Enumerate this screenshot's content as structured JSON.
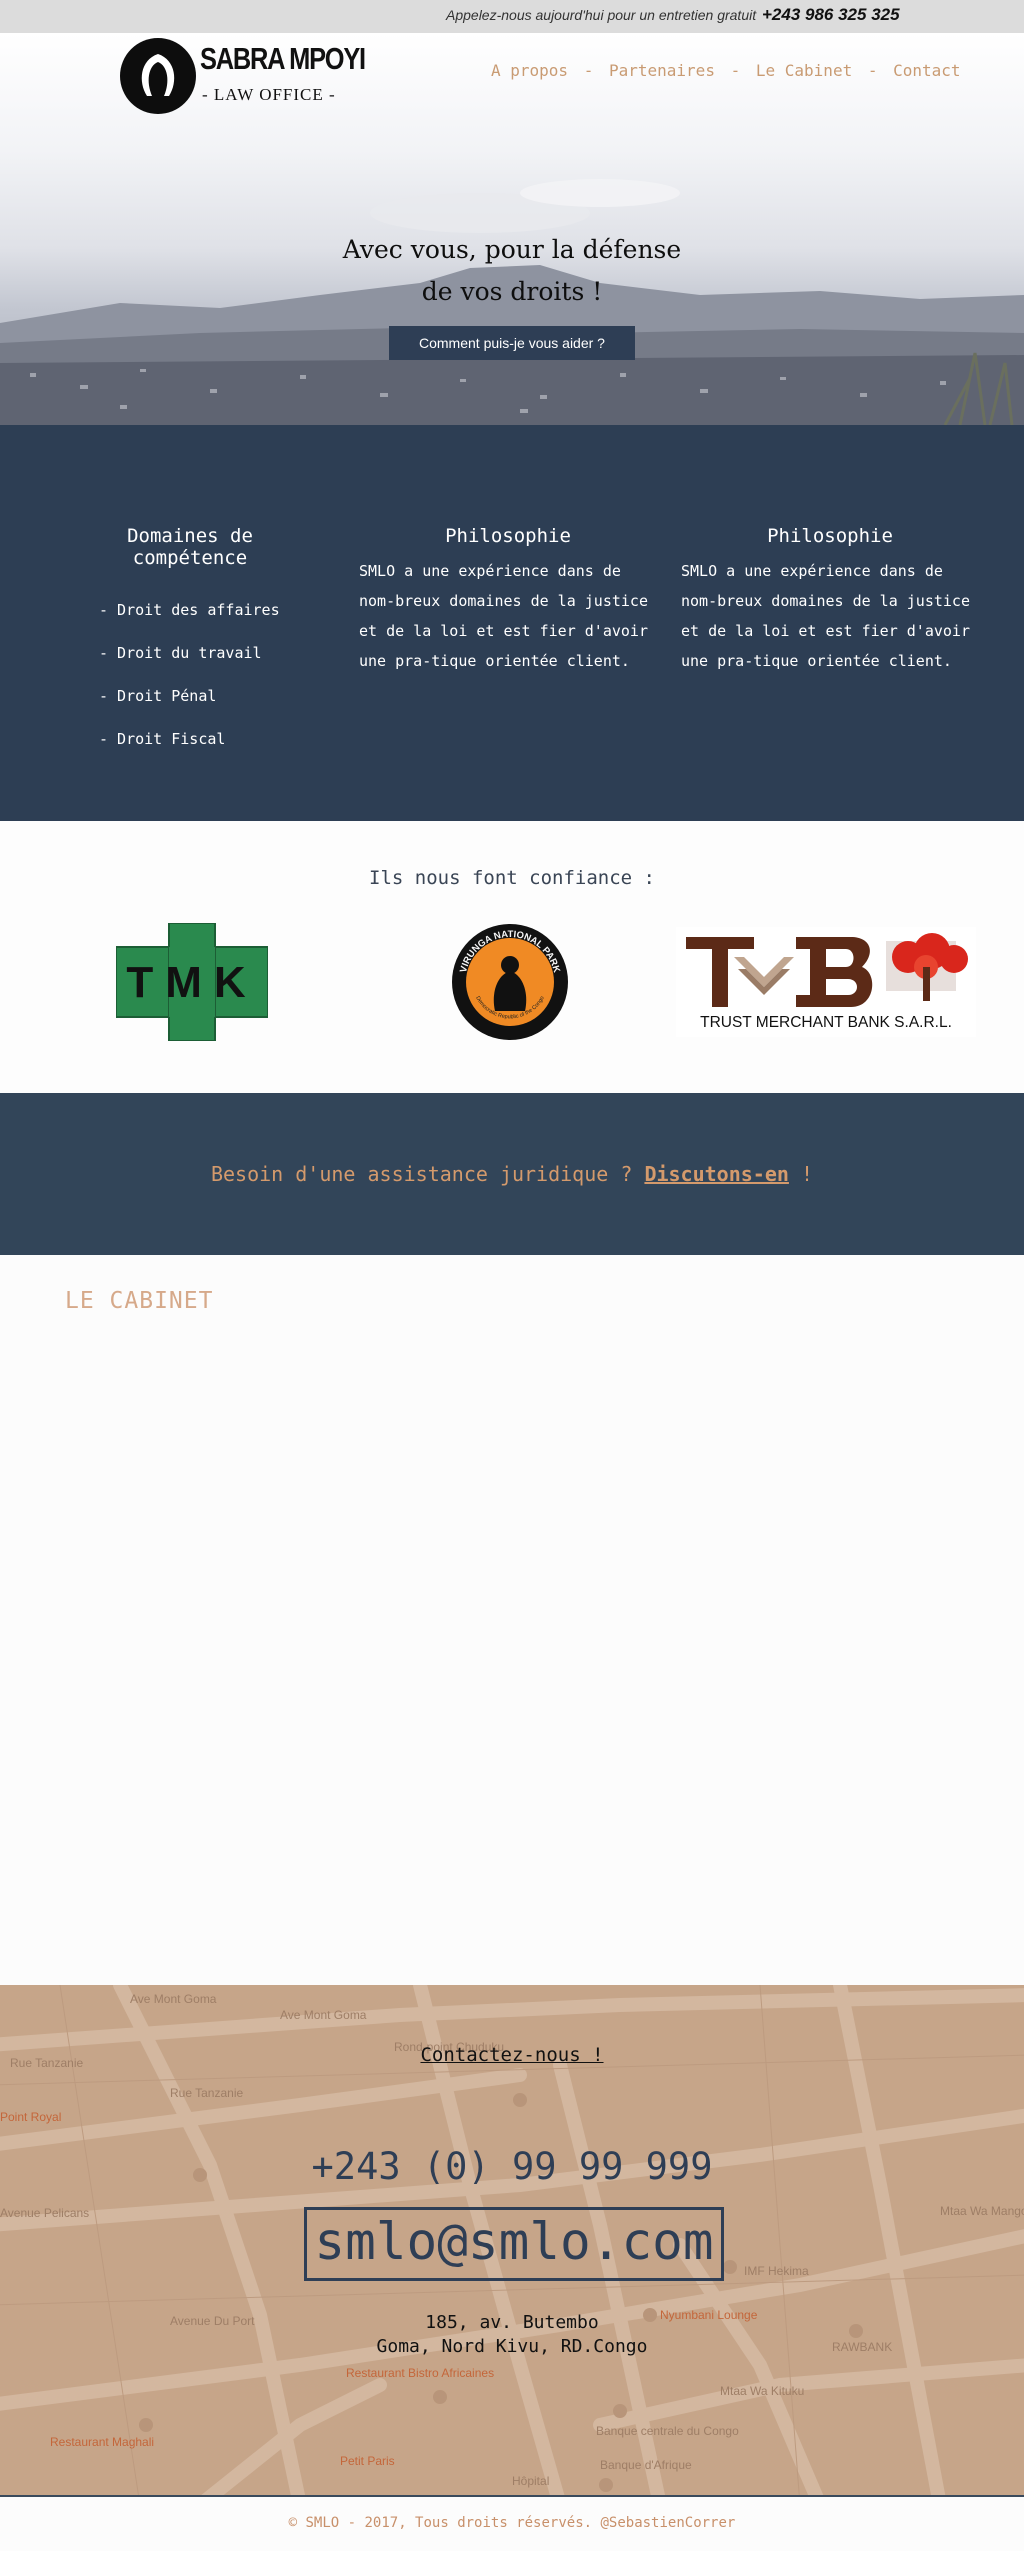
{
  "topbar": {
    "call_text": "Appelez-nous aujourd'hui pour un entretien gratuit",
    "phone": "+243 986 325 325"
  },
  "logo": {
    "name": "SABRA MPOYI",
    "sub": "- LAW OFFICE -"
  },
  "nav": {
    "items": [
      "A propos",
      "Partenaires",
      "Le Cabinet",
      "Contact"
    ],
    "separator": "-"
  },
  "hero": {
    "title_line1": "Avec vous, pour la défense",
    "title_line2": "de vos droits !",
    "button_label": "Comment puis-je vous aider ?"
  },
  "services": {
    "domains": {
      "title": "Domaines de compétence",
      "items": [
        "- Droit des affaires",
        "- Droit du travail",
        "- Droit Pénal",
        "- Droit Fiscal"
      ]
    },
    "philosophy1": {
      "title": "Philosophie",
      "text": "SMLO a une expérience dans de nom-breux domaines de la justice et de la loi et est fier d'avoir une pra-tique orientée client."
    },
    "philosophy2": {
      "title": "Philosophie",
      "text": "SMLO a une expérience dans de nom-breux domaines de la justice et de la loi et est fier d'avoir une pra-tique orientée client."
    }
  },
  "partners": {
    "title": "Ils nous font confiance :",
    "logos": [
      {
        "text": "TMK",
        "color": "#2a8a4e"
      },
      {
        "text": "VIRUNGA NATIONAL PARK",
        "sub": "Democratic Republic of the Congo",
        "color": "#f08a24"
      },
      {
        "text": "TMB",
        "sub": "TRUST MERCHANT BANK S.A.R.L.",
        "color": "#5c2a17"
      }
    ]
  },
  "cta": {
    "text": "Besoin d'une assistance juridique ?",
    "link": "Discutons-en",
    "end": "!"
  },
  "cabinet": {
    "title": "LE CABINET"
  },
  "contact": {
    "heading": "Contactez-nous !",
    "phone": "+243 (0) 99 99 999",
    "email": "smlo@smlo.com",
    "address_line1": "185, av. Butembo",
    "address_line2": "Goma, Nord Kivu, RD.Congo",
    "map_labels": [
      "Ave Mont Goma",
      "Ave Mont Goma",
      "Rue Tanzanie",
      "Rue Tanzanie",
      "Point Royal",
      "Avenue Pelicans",
      "Avenue Du Port",
      "Restaurant Maghali",
      "Petit Paris",
      "Banque centrale du Congo",
      "Banque d'Afrique",
      "IMF Hekima",
      "Nyumbani Lounge",
      "RAWBANK",
      "Mtaa Wa Mangobe",
      "Mtaa Wa Kituku",
      "Restaurant Bistro Africaines",
      "Hôpital",
      "Rond-point Chuduku"
    ]
  },
  "footer": {
    "text": "© SMLO - 2017, Tous droits réservés. @SebastienCorrer"
  },
  "colors": {
    "navy": "#2d3e54",
    "accent": "#c99b73",
    "map": "#c6a589"
  }
}
